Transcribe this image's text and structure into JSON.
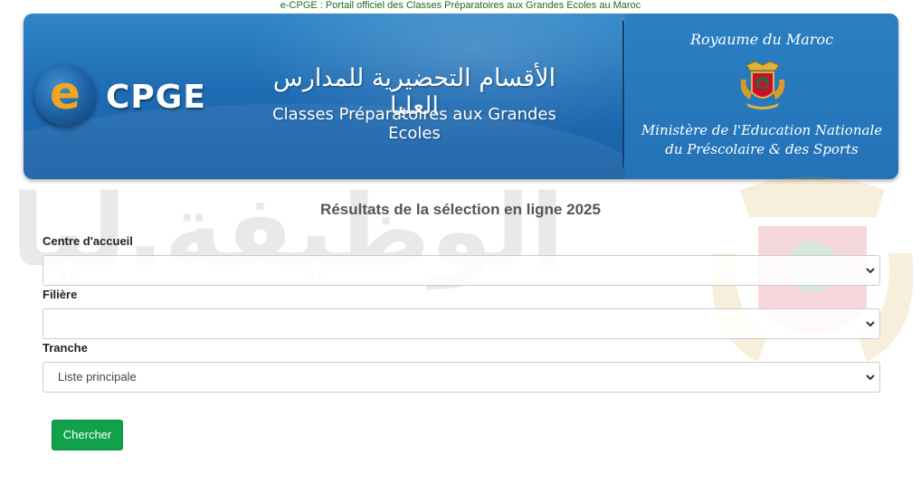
{
  "top_tagline": "e-CPGE : Portail officiel des Classes Préparatoires aux Grandes Ecoles au Maroc",
  "header": {
    "logo_letter": "e",
    "logo_text": "CPGE",
    "title_arabic": "الأقسام التحضيرية للمدارس العليا",
    "title_french": "Classes Préparatoires aux Grandes Ecoles",
    "kingdom": "Royaume du Maroc",
    "ministry_line1": "Ministère de l'Education Nationale",
    "ministry_line2": "du Préscolaire & des Sports"
  },
  "watermark_text": "الوظيفة.ليا",
  "form": {
    "title": "Résultats de la sélection en ligne 2025",
    "fields": [
      {
        "label": "Centre d'accueil",
        "value": ""
      },
      {
        "label": "Filière",
        "value": ""
      },
      {
        "label": "Tranche",
        "value": "Liste principale"
      }
    ],
    "submit_label": "Chercher"
  },
  "colors": {
    "banner_blue": "#1f6db4",
    "logo_orange": "#f2a51d",
    "button_green": "#10a14a",
    "tagline_green": "#1a6e1a"
  }
}
